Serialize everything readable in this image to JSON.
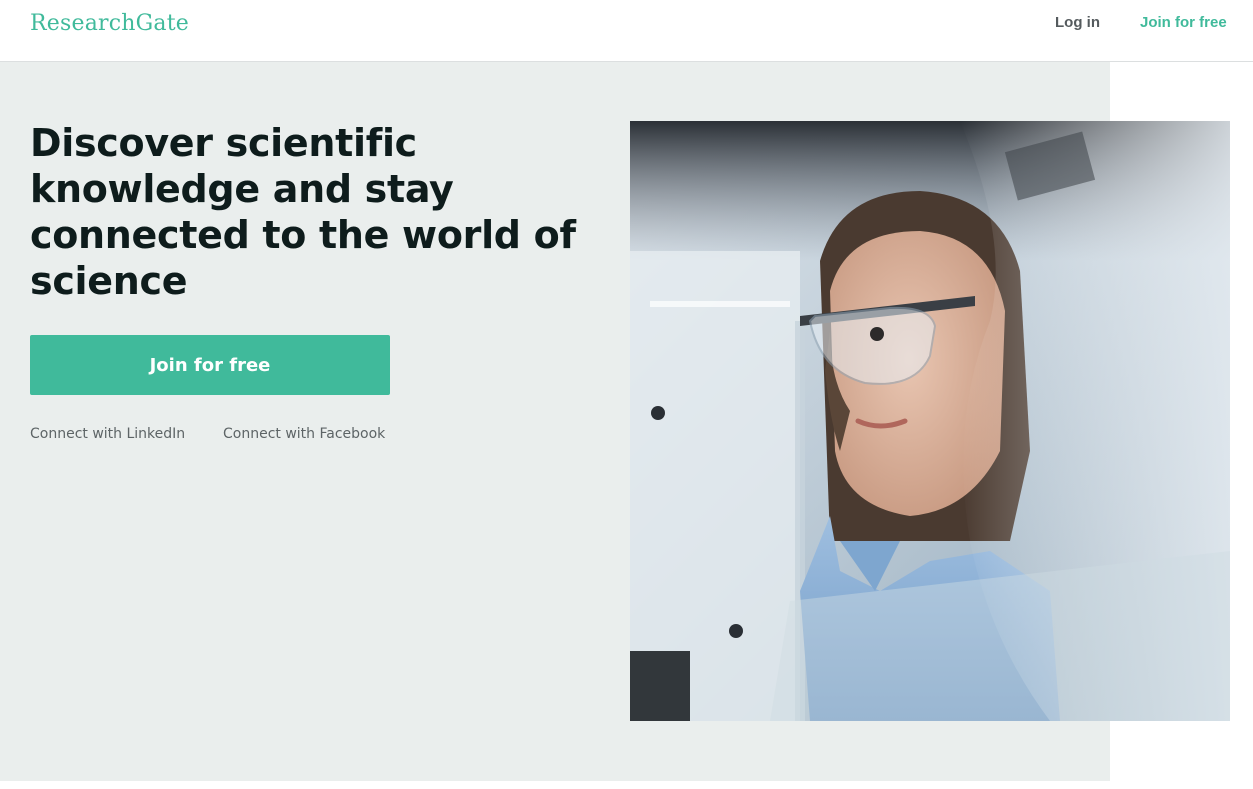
{
  "header": {
    "logo_text": "ResearchGate",
    "login_label": "Log in",
    "join_label": "Join for free"
  },
  "hero": {
    "headline": "Discover scientific knowledge and stay connected to the world of science",
    "cta_label": "Join for free",
    "linkedin_label": "Connect with LinkedIn",
    "facebook_label": "Connect with Facebook"
  },
  "colors": {
    "brand": "#40ba9b",
    "hero_background": "#eaeeed",
    "headline_text": "#0e1c1c",
    "secondary_text": "#5d6466"
  }
}
